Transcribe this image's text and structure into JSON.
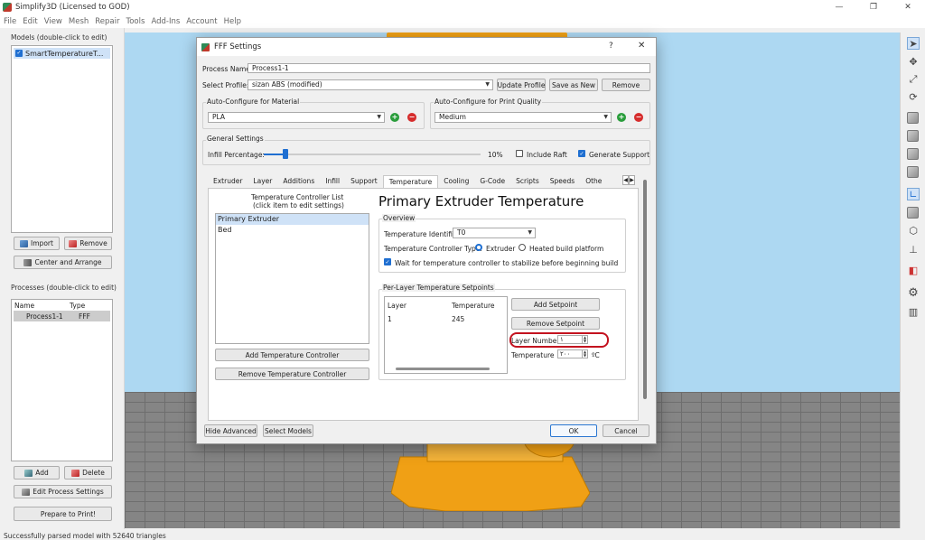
{
  "app": {
    "title": "Simplify3D (Licensed to GOD)",
    "window_buttons": [
      "—",
      "❐",
      "✕"
    ]
  },
  "menu": [
    "File",
    "Edit",
    "View",
    "Mesh",
    "Repair",
    "Tools",
    "Add-Ins",
    "Account",
    "Help"
  ],
  "models_panel": {
    "label": "Models (double-click to edit)",
    "items": [
      "SmartTemperatureT..."
    ],
    "import_label": "Import",
    "remove_label": "Remove",
    "center_label": "Center and Arrange"
  },
  "processes_panel": {
    "label": "Processes (double-click to edit)",
    "col_name": "Name",
    "col_type": "Type",
    "rows": [
      {
        "name": "Process1-1",
        "type": "FFF"
      }
    ],
    "add_label": "Add",
    "delete_label": "Delete",
    "edit_label": "Edit Process Settings",
    "prepare_label": "Prepare to Print!"
  },
  "status": "Successfully parsed model with 52640 triangles",
  "dialog": {
    "title": "FFF Settings",
    "help": "?",
    "close": "✕",
    "process_name_label": "Process Name:",
    "process_name": "Process1-1",
    "select_profile_label": "Select Profile:",
    "profile": "sizan ABS  (modified)",
    "update_profile": "Update Profile",
    "save_as_new": "Save as New",
    "remove": "Remove",
    "material_group": "Auto-Configure for Material",
    "material": "PLA",
    "quality_group": "Auto-Configure for Print Quality",
    "quality": "Medium",
    "general_group": "General Settings",
    "infill_label": "Infill Percentage:",
    "infill_value": "10%",
    "infill_fraction": 0.1,
    "include_raft": "Include Raft",
    "include_raft_checked": false,
    "generate_support": "Generate Support",
    "generate_support_checked": true,
    "tabs": [
      "Extruder",
      "Layer",
      "Additions",
      "Infill",
      "Support",
      "Temperature",
      "Cooling",
      "G-Code",
      "Scripts",
      "Speeds",
      "Other"
    ],
    "active_tab": "Temperature",
    "controller_list_title_1": "Temperature Controller List",
    "controller_list_title_2": "(click item to edit settings)",
    "controllers": [
      "Primary Extruder",
      "Bed"
    ],
    "add_controller": "Add Temperature Controller",
    "remove_controller": "Remove Temperature Controller",
    "section_title": "Primary Extruder Temperature",
    "overview_group": "Overview",
    "temp_identifier_label": "Temperature Identifier",
    "temp_identifier": "T0",
    "controller_type_label": "Temperature Controller Type:",
    "type_extruder": "Extruder",
    "type_bed": "Heated build platform",
    "wait_label": "Wait for temperature controller to stabilize before beginning build",
    "setpoints_group": "Per-Layer Temperature Setpoints",
    "col_layer": "Layer",
    "col_temperature": "Temperature",
    "setpoints": [
      {
        "layer": "1",
        "temperature": "245"
      }
    ],
    "add_setpoint": "Add Setpoint",
    "remove_setpoint": "Remove Setpoint",
    "layer_number_label": "Layer Number",
    "layer_number": "١",
    "temperature_label": "Temperature",
    "temperature_value": "٢٠٠",
    "temperature_unit": "ºC",
    "hide_advanced": "Hide Advanced",
    "select_models": "Select Models",
    "ok": "OK",
    "cancel": "Cancel"
  },
  "colors": {
    "accent": "#1f6fd1",
    "viewport_sky": "#add8f2",
    "floor": "#858585",
    "model_orange": "#f0a015",
    "highlight_red": "#c3121f"
  }
}
